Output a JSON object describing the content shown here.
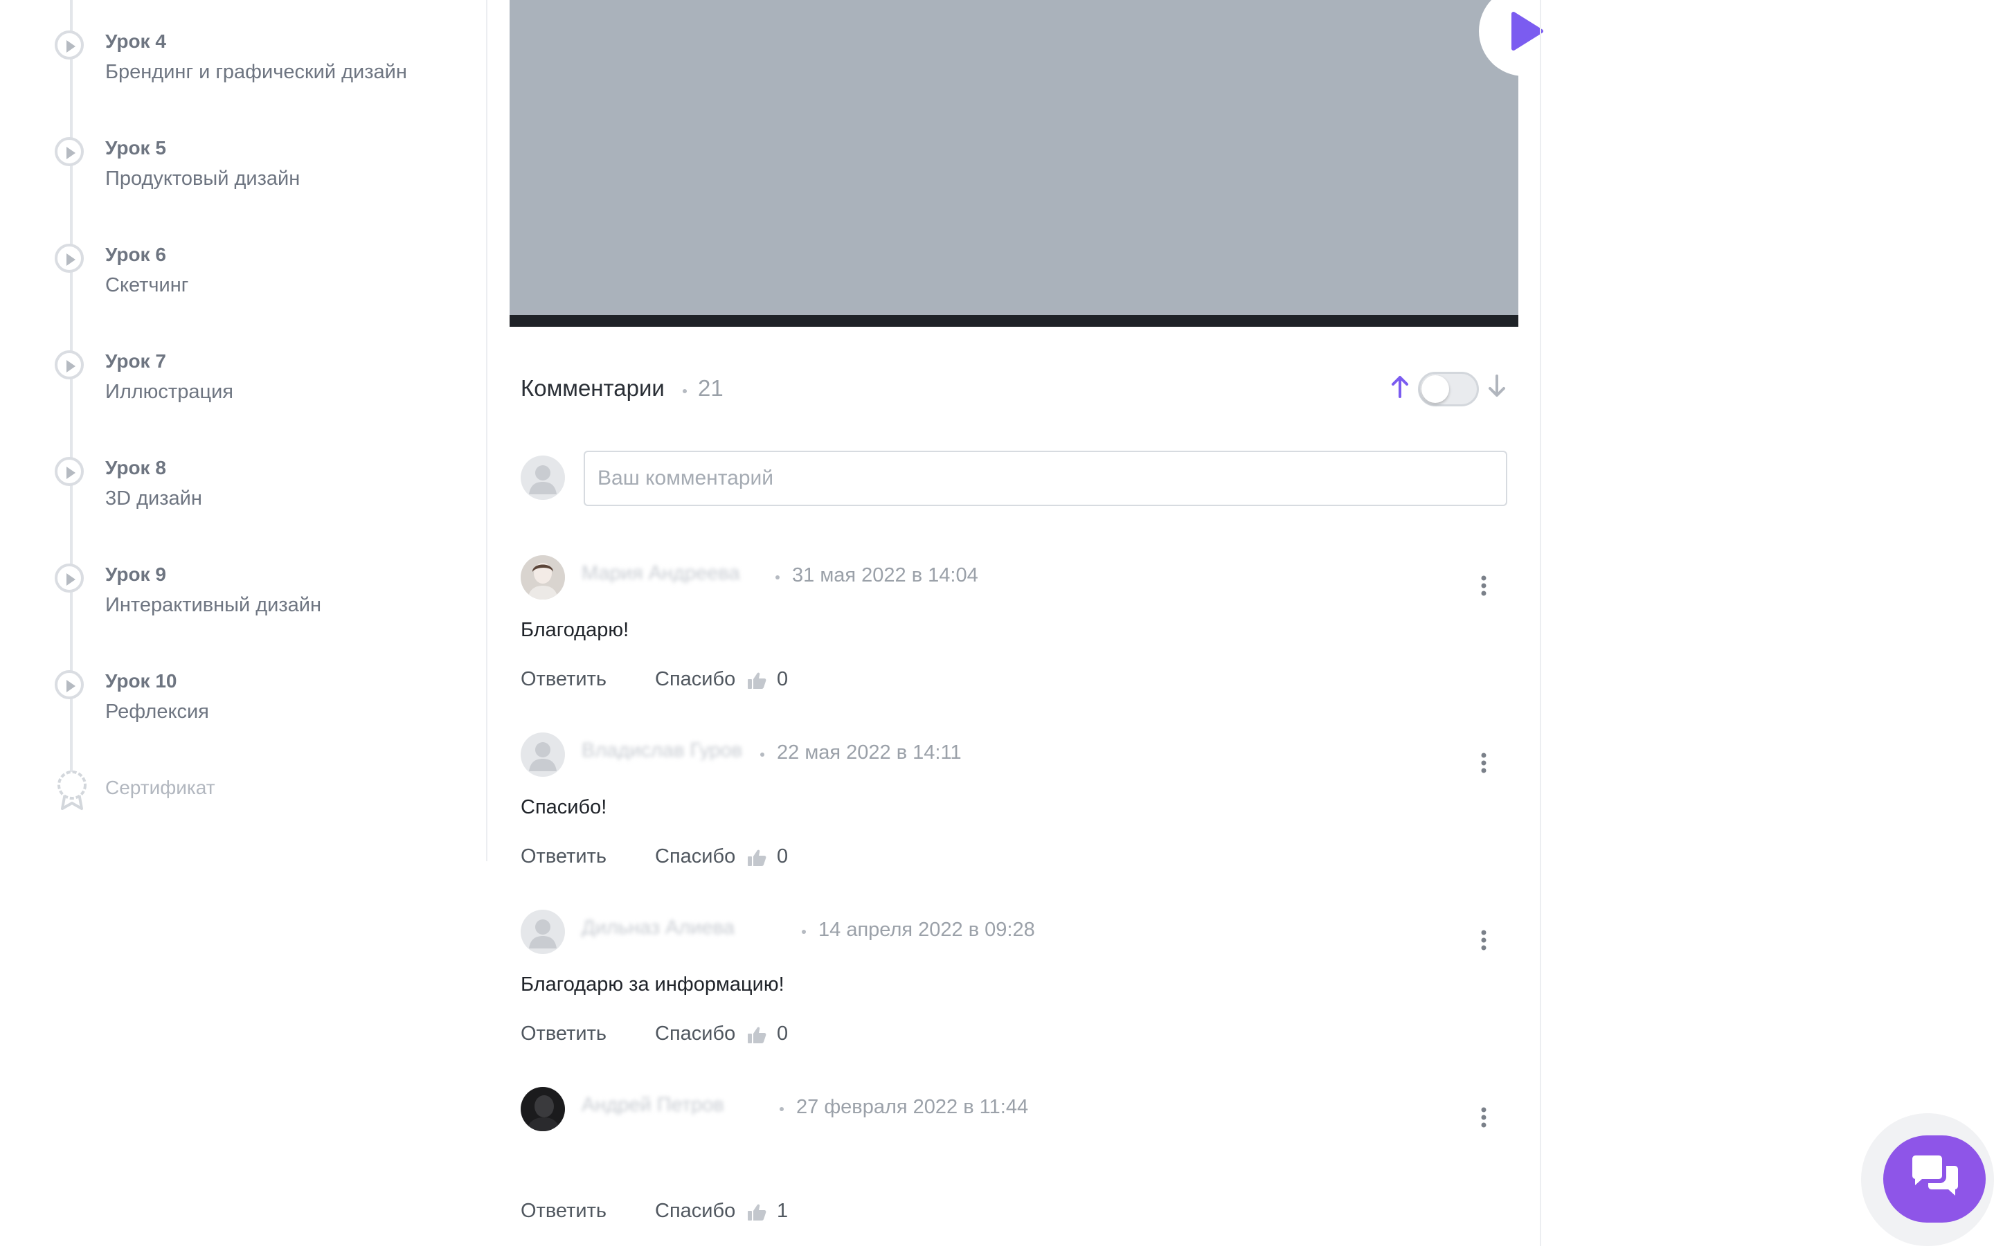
{
  "sidebar": {
    "lessons": [
      {
        "number": "Урок 4",
        "title": "Брендинг и графический дизайн"
      },
      {
        "number": "Урок 5",
        "title": "Продуктовый дизайн"
      },
      {
        "number": "Урок 6",
        "title": "Скетчинг"
      },
      {
        "number": "Урок 7",
        "title": "Иллюстрация"
      },
      {
        "number": "Урок 8",
        "title": "3D дизайн"
      },
      {
        "number": "Урок 9",
        "title": "Интерактивный дизайн"
      },
      {
        "number": "Урок 10",
        "title": "Рефлексия"
      }
    ],
    "certificate_label": "Сертификат"
  },
  "video": {
    "play_icon": "play-icon"
  },
  "comments": {
    "title": "Комментарии",
    "count": "21",
    "sort_icons": [
      "arrow-up-icon",
      "arrow-down-icon"
    ],
    "input_placeholder": "Ваш комментарий",
    "items": [
      {
        "author": "Мария Андреева",
        "date": "31 мая 2022 в 14:04",
        "text": "Благодарю!",
        "reply_label": "Ответить",
        "thanks_label": "Спасибо",
        "likes": "0"
      },
      {
        "author": "Владислав Гуров",
        "date": "22 мая 2022 в 14:11",
        "text": "Спасибо!",
        "reply_label": "Ответить",
        "thanks_label": "Спасибо",
        "likes": "0"
      },
      {
        "author": "Дильназ Алиева",
        "date": "14 апреля 2022 в 09:28",
        "text": "Благодарю за информацию!",
        "reply_label": "Ответить",
        "thanks_label": "Спасибо",
        "likes": "0"
      },
      {
        "author": "Андрей Петров",
        "date": "27 февраля 2022 в 11:44",
        "text": "",
        "reply_label": "Ответить",
        "thanks_label": "Спасибо",
        "likes": "1"
      }
    ]
  },
  "colors": {
    "accent": "#8e55e8",
    "sort_active": "#7b5cf0",
    "muted_text": "#9ba1a9",
    "video_placeholder": "#aab2bb"
  },
  "chat_fab": {
    "icon": "chat-bubbles-icon"
  }
}
